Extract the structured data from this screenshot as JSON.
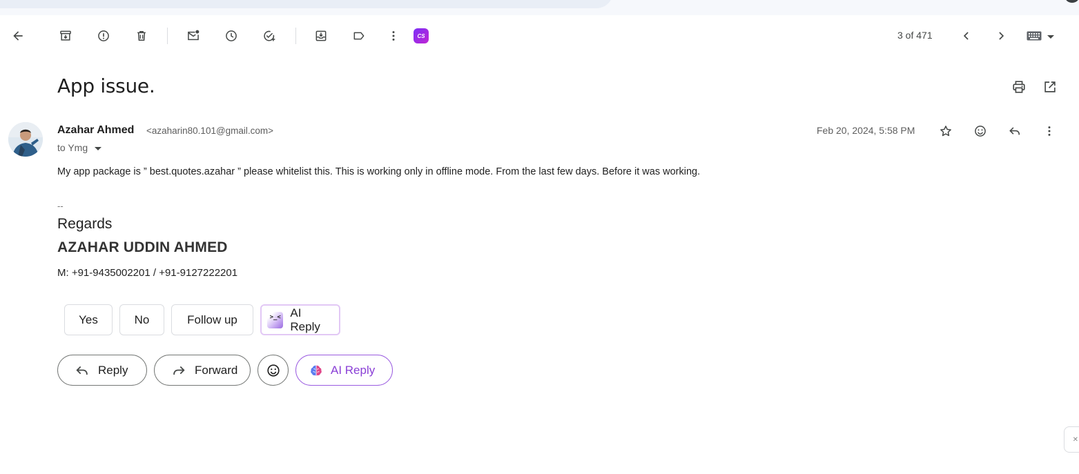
{
  "toolbar": {
    "icons": [
      "back-arrow-icon",
      "archive-icon",
      "report-spam-icon",
      "delete-icon",
      "mark-unread-icon",
      "snooze-icon",
      "add-to-tasks-icon",
      "move-to-icon",
      "label-icon",
      "more-vert-icon",
      "cs-extension-icon"
    ],
    "cs_badge": "CS",
    "pager": "3 of 471"
  },
  "email": {
    "subject": "App issue.",
    "sender_name": "Azahar Ahmed",
    "sender_email": "<azaharin80.101@gmail.com>",
    "recipient": "to Ymg",
    "date": "Feb 20, 2024, 5:58 PM",
    "body": "My app package is ” best.quotes.azahar ” please whitelist this. This is working only in offline mode. From the last few days. Before it was working.",
    "signature": {
      "dash": "--",
      "regards": "Regards",
      "name": "AZAHAR UDDIN AHMED",
      "phone": "M: +91-9435002201 / +91-9127222201"
    }
  },
  "smart_replies": [
    {
      "label": "Yes"
    },
    {
      "label": "No"
    },
    {
      "label": "Follow up"
    },
    {
      "label": "AI Reply",
      "icon_text": ">_<"
    }
  ],
  "actions": {
    "reply": "Reply",
    "forward": "Forward",
    "ai_reply": "AI Reply"
  },
  "colors": {
    "accent_purple": "#8a3fd6",
    "icon_gray": "#444746",
    "border_gray": "#747775"
  }
}
